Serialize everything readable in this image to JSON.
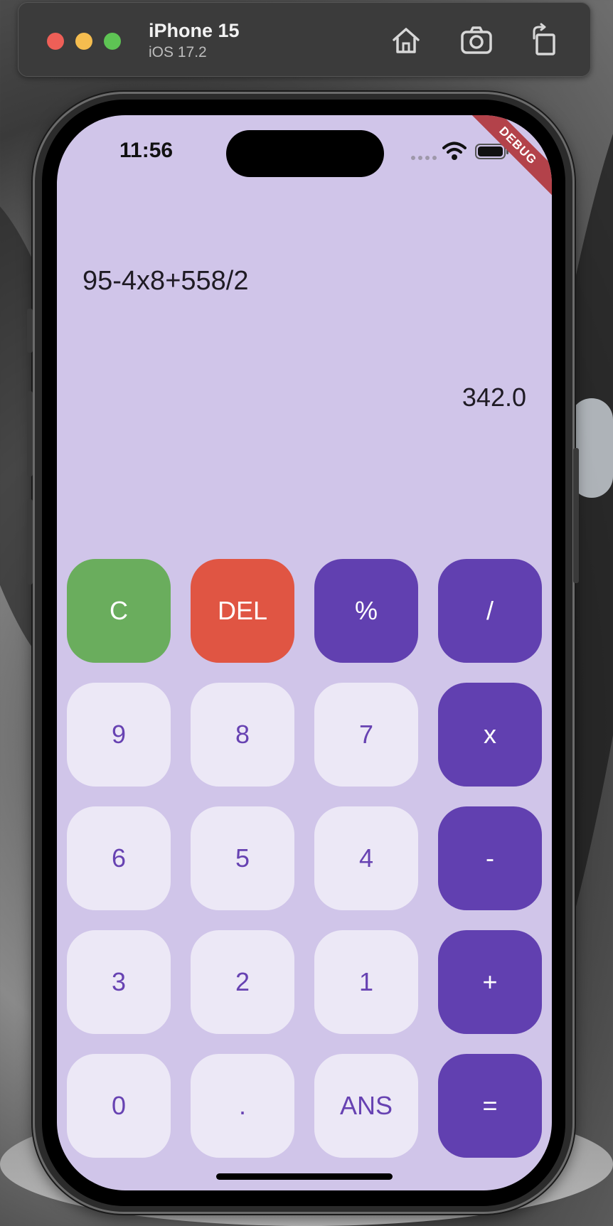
{
  "simulator": {
    "device_name": "iPhone 15",
    "os_version": "iOS 17.2",
    "toolbar_icons": [
      "home-icon",
      "screenshot-icon",
      "rotate-icon"
    ]
  },
  "status_bar": {
    "time": "11:56"
  },
  "debug_banner": "DEBUG",
  "display": {
    "expression": "95-4x8+558/2",
    "result": "342.0"
  },
  "keypad": {
    "rows": [
      [
        {
          "label": "C",
          "kind": "clear"
        },
        {
          "label": "DEL",
          "kind": "del"
        },
        {
          "label": "%",
          "kind": "op"
        },
        {
          "label": "/",
          "kind": "op"
        }
      ],
      [
        {
          "label": "9",
          "kind": "num"
        },
        {
          "label": "8",
          "kind": "num"
        },
        {
          "label": "7",
          "kind": "num"
        },
        {
          "label": "x",
          "kind": "op"
        }
      ],
      [
        {
          "label": "6",
          "kind": "num"
        },
        {
          "label": "5",
          "kind": "num"
        },
        {
          "label": "4",
          "kind": "num"
        },
        {
          "label": "-",
          "kind": "op"
        }
      ],
      [
        {
          "label": "3",
          "kind": "num"
        },
        {
          "label": "2",
          "kind": "num"
        },
        {
          "label": "1",
          "kind": "num"
        },
        {
          "label": "+",
          "kind": "op"
        }
      ],
      [
        {
          "label": "0",
          "kind": "num"
        },
        {
          "label": ".",
          "kind": "num"
        },
        {
          "label": "ANS",
          "kind": "num"
        },
        {
          "label": "=",
          "kind": "op"
        }
      ]
    ]
  },
  "colors": {
    "screen_background": "#d0c5e9",
    "number_key": "#ece8f6",
    "operator_key": "#6140b0",
    "clear_key": "#6aad5d",
    "delete_key": "#e05543"
  }
}
